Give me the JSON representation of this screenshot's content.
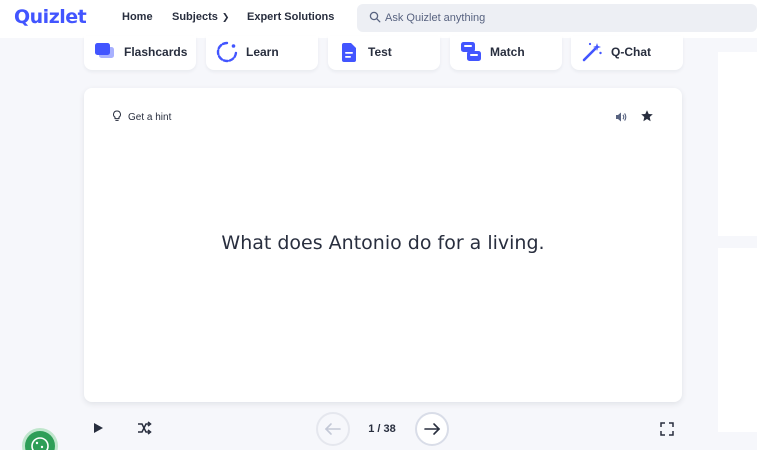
{
  "header": {
    "logo": "Quizlet",
    "nav": {
      "home": "Home",
      "subjects": "Subjects",
      "expert": "Expert Solutions"
    },
    "search": {
      "placeholder": "Ask Quizlet anything"
    }
  },
  "modes": [
    {
      "label": "Flashcards",
      "icon": "flashcards-icon",
      "color": "#4255ff"
    },
    {
      "label": "Learn",
      "icon": "learn-icon",
      "color": "#4255ff"
    },
    {
      "label": "Test",
      "icon": "test-icon",
      "color": "#4255ff"
    },
    {
      "label": "Match",
      "icon": "match-icon",
      "color": "#4255ff"
    },
    {
      "label": "Q-Chat",
      "icon": "magic-wand-icon",
      "color": "#4255ff"
    }
  ],
  "card": {
    "hint": "Get a hint",
    "term": "What does Antonio do for a living."
  },
  "controls": {
    "counter": "1 / 38"
  },
  "colors": {
    "brand": "#4255ff",
    "background": "#f6f7fb",
    "text": "#282e3e",
    "cookie": "#2e9e57"
  }
}
